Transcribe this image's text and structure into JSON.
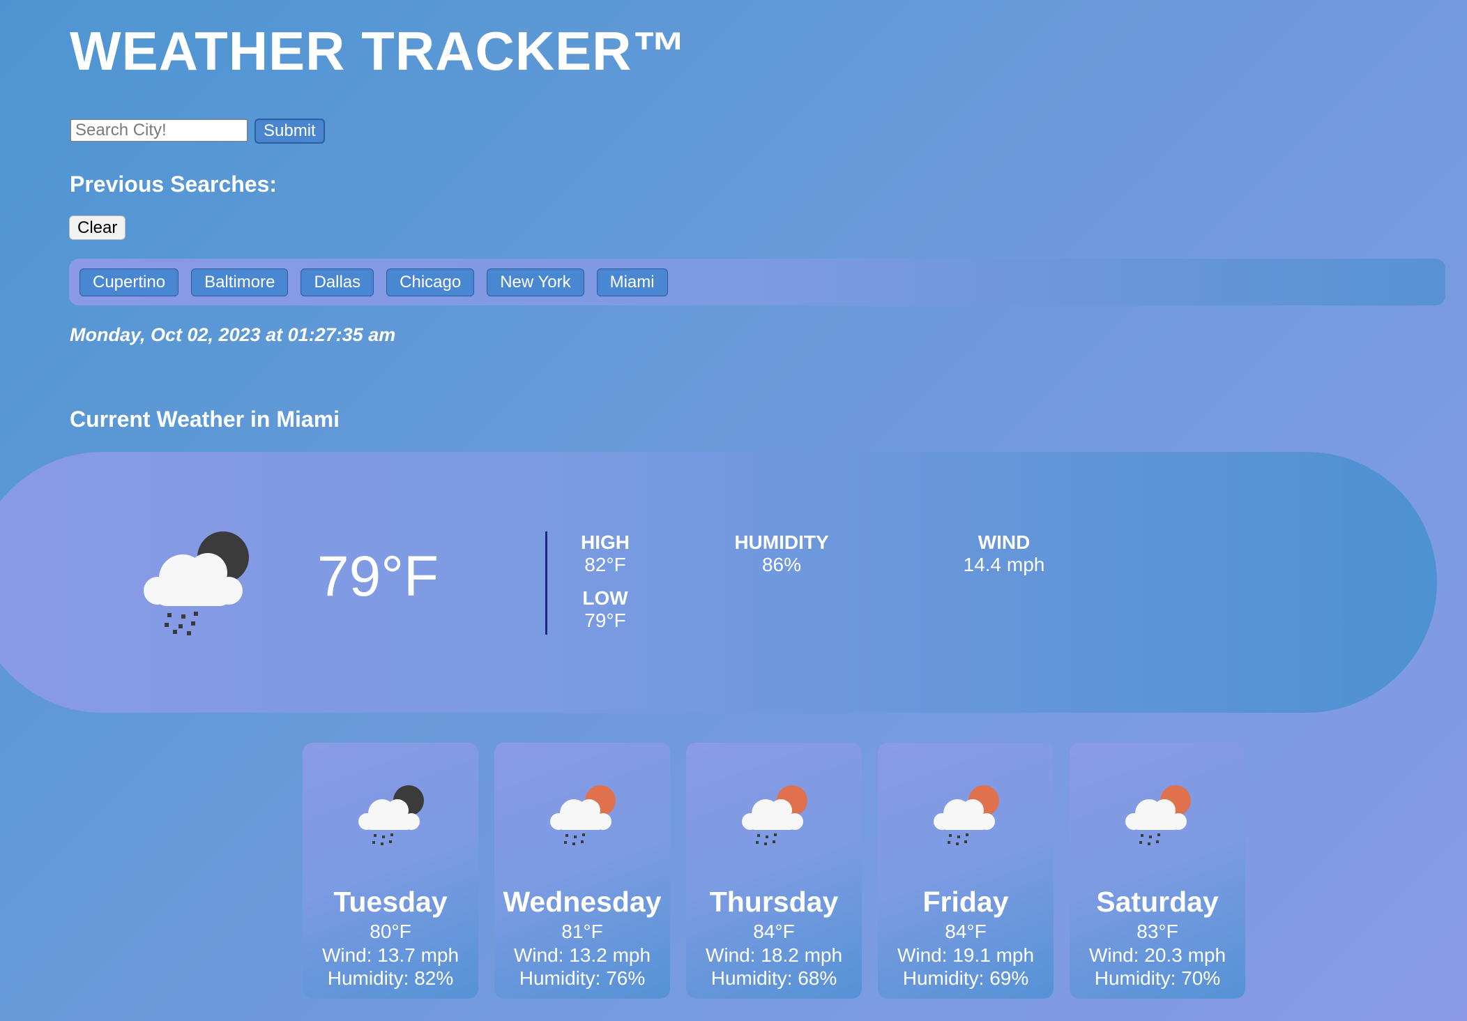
{
  "header": {
    "title": "WEATHER TRACKER™"
  },
  "search": {
    "placeholder": "Search City!",
    "value": "",
    "submit_label": "Submit"
  },
  "history": {
    "heading": "Previous Searches:",
    "clear_label": "Clear",
    "cities": [
      "Cupertino",
      "Baltimore",
      "Dallas",
      "Chicago",
      "New York",
      "Miami"
    ]
  },
  "datetime": "Monday, Oct 02, 2023 at 01:27:35 am",
  "current": {
    "heading": "Current Weather in Miami",
    "icon": "rain-cloud-moon-icon",
    "temp": "79°F",
    "high_label": "HIGH",
    "high": "82°F",
    "low_label": "LOW",
    "low": "79°F",
    "humidity_label": "HUMIDITY",
    "humidity": "86%",
    "wind_label": "WIND",
    "wind": "14.4 mph"
  },
  "forecast": [
    {
      "day": "Tuesday",
      "temp": "80°F",
      "wind": "Wind: 13.7 mph",
      "humidity": "Humidity: 82%",
      "icon": "rain-cloud-moon-icon"
    },
    {
      "day": "Wednesday",
      "temp": "81°F",
      "wind": "Wind: 13.2 mph",
      "humidity": "Humidity: 76%",
      "icon": "rain-cloud-sun-icon"
    },
    {
      "day": "Thursday",
      "temp": "84°F",
      "wind": "Wind: 18.2 mph",
      "humidity": "Humidity: 68%",
      "icon": "rain-cloud-sun-icon"
    },
    {
      "day": "Friday",
      "temp": "84°F",
      "wind": "Wind: 19.1 mph",
      "humidity": "Humidity: 69%",
      "icon": "rain-cloud-sun-icon"
    },
    {
      "day": "Saturday",
      "temp": "83°F",
      "wind": "Wind: 20.3 mph",
      "humidity": "Humidity: 70%",
      "icon": "rain-cloud-sun-icon"
    }
  ],
  "colors": {
    "moon": "#3b3b3b",
    "sun": "#e0714e",
    "cloud": "#f7f7f7",
    "rain": "#3a3a3a",
    "divider": "#1a2a80"
  }
}
